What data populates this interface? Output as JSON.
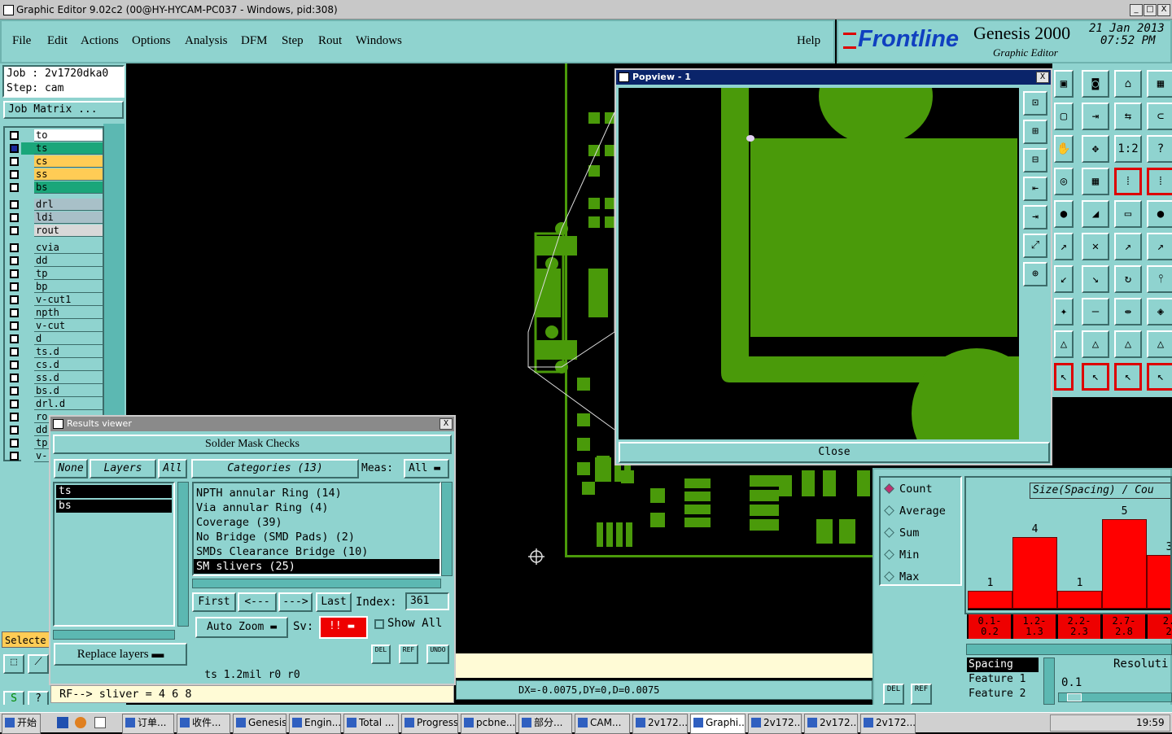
{
  "window": {
    "title": "Graphic Editor 9.02c2 (00@HY-HYCAM-PC037 - Windows, pid:308)",
    "min": "_",
    "max": "□",
    "close": "X"
  },
  "menu": {
    "items": [
      "File",
      "Edit",
      "Actions",
      "Options",
      "Analysis",
      "DFM",
      "Step",
      "Rout",
      "Windows"
    ],
    "help": "Help"
  },
  "brand": {
    "logo": "Frontline",
    "product": "Genesis 2000",
    "sub": "Graphic Editor",
    "date": "21 Jan 2013",
    "time": "07:52 PM"
  },
  "job": {
    "job_label": "Job : 2v1720dka0",
    "step_label": "Step: cam",
    "matrix_btn": "Job Matrix ..."
  },
  "layers": [
    {
      "name": "to",
      "color": "#ffffff"
    },
    {
      "name": "ts",
      "color": "#1aa67a"
    },
    {
      "name": "cs",
      "color": "#ffcc55"
    },
    {
      "name": "ss",
      "color": "#ffcc55"
    },
    {
      "name": "bs",
      "color": "#1aa67a"
    },
    {
      "name": "drl",
      "color": "#a8c0c8"
    },
    {
      "name": "ldi",
      "color": "#a8c0c8"
    },
    {
      "name": "rout",
      "color": "#d8d8d8"
    },
    {
      "name": "cvia",
      "color": "#8fd3cf"
    },
    {
      "name": "dd",
      "color": "#8fd3cf"
    },
    {
      "name": "tp",
      "color": "#8fd3cf"
    },
    {
      "name": "bp",
      "color": "#8fd3cf"
    },
    {
      "name": "v-cut1",
      "color": "#8fd3cf"
    },
    {
      "name": "npth",
      "color": "#8fd3cf"
    },
    {
      "name": "v-cut",
      "color": "#8fd3cf"
    },
    {
      "name": "d",
      "color": "#8fd3cf"
    },
    {
      "name": "ts.d",
      "color": "#8fd3cf"
    },
    {
      "name": "cs.d",
      "color": "#8fd3cf"
    },
    {
      "name": "ss.d",
      "color": "#8fd3cf"
    },
    {
      "name": "bs.d",
      "color": "#8fd3cf"
    },
    {
      "name": "drl.d",
      "color": "#8fd3cf"
    },
    {
      "name": "ro",
      "color": "#8fd3cf"
    },
    {
      "name": "dd",
      "color": "#8fd3cf"
    },
    {
      "name": "tp",
      "color": "#8fd3cf"
    },
    {
      "name": "v-",
      "color": "#8fd3cf"
    }
  ],
  "selected_label": "Selecte",
  "popview": {
    "title": "Popview - 1",
    "close_btn": "Close"
  },
  "results": {
    "title": "Results viewer",
    "header": "Solder Mask Checks",
    "none_btn": "None",
    "layers_btn": "Layers",
    "all_btn": "All",
    "categories_btn": "Categories (13)",
    "meas_label": "Meas:",
    "meas_value": "All",
    "layer_list": [
      "ts",
      "bs"
    ],
    "categories": [
      "NPTH annular Ring (14)",
      "Via annular Ring (4)",
      "Coverage (39)",
      "No Bridge (SMD Pads) (2)",
      "SMDs Clearance Bridge (10)",
      "SM slivers (25)"
    ],
    "first": "First",
    "prev": "<---",
    "next": "--->",
    "last": "Last",
    "index_label": "Index:",
    "index_value": "361",
    "auto_zoom": "Auto Zoom",
    "sv_label": "Sv:",
    "sv_value": "!!",
    "show_all": "Show All",
    "replace_layers": "Replace layers",
    "del": "DEL",
    "ref": "REF",
    "undo": "UNDO",
    "status": "ts 1.2mil  r0  r0"
  },
  "cmdline": "RF--> sliver = 4 6 8",
  "coords": "DX=-0.0075,DY=0,D=0.0075",
  "stats": {
    "options": [
      "Count",
      "Average",
      "Sum",
      "Min",
      "Max"
    ],
    "selected": "Count",
    "del": "DEL",
    "ref": "REF"
  },
  "histogram": {
    "title": "Size(Spacing) / Cou",
    "bins": [
      "0.1-\n0.2",
      "1.2-\n1.3",
      "2.2-\n2.3",
      "2.7-\n2.8",
      "2.\n2"
    ],
    "counts": [
      1,
      4,
      1,
      5,
      3
    ],
    "list": [
      "Spacing",
      "Feature 1",
      "Feature 2"
    ],
    "resolution_label": "Resoluti",
    "resolution_value": "0.1"
  },
  "chart_data": {
    "type": "bar",
    "title": "Size(Spacing) / Cou",
    "categories": [
      "0.1-0.2",
      "1.2-1.3",
      "2.2-2.3",
      "2.7-2.8",
      "2."
    ],
    "values": [
      1,
      4,
      1,
      5,
      3
    ]
  },
  "taskbar": {
    "start": "开始",
    "items": [
      "订单...",
      "收件...",
      "Genesis",
      "Engin...",
      "Total ...",
      "Progress",
      "pcbne...",
      "部分...",
      "CAM...",
      "2v172...",
      "Graphi...",
      "2v172...",
      "2v172...",
      "2v172..."
    ],
    "clock": "19:59"
  }
}
